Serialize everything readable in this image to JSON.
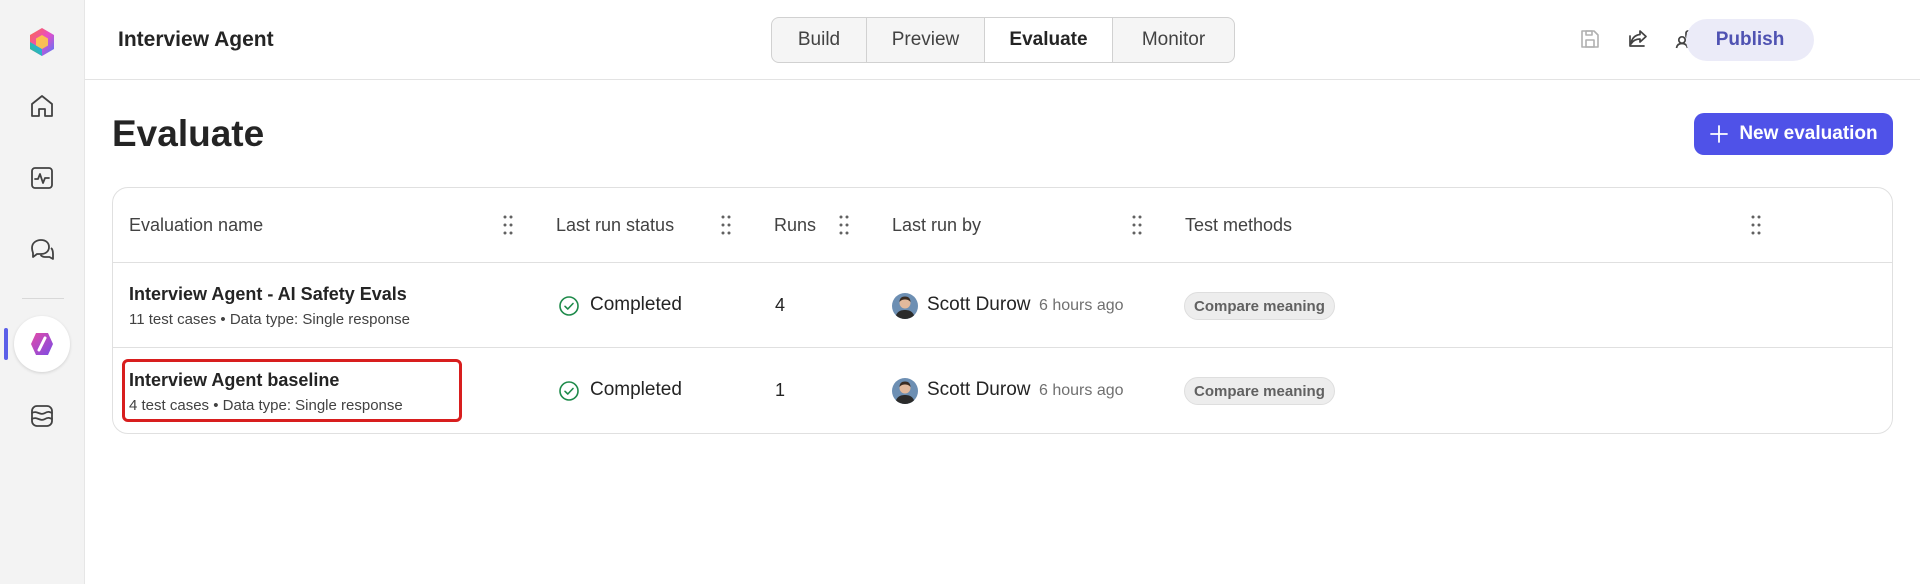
{
  "header": {
    "title": "Interview Agent",
    "tabs": [
      {
        "label": "Build",
        "active": false
      },
      {
        "label": "Preview",
        "active": false
      },
      {
        "label": "Evaluate",
        "active": true
      },
      {
        "label": "Monitor",
        "active": false
      }
    ],
    "icons": [
      "save-icon",
      "share-icon",
      "agent-settings-icon",
      "more-icon"
    ],
    "publish_label": "Publish"
  },
  "rail": {
    "items": [
      "copilot-logo-icon",
      "home-icon",
      "analytics-icon",
      "chat-icon",
      "agents-icon",
      "library-icon"
    ],
    "active_item": "agents-icon"
  },
  "main": {
    "title": "Evaluate",
    "new_button_label": "New evaluation"
  },
  "table": {
    "columns": [
      "Evaluation name",
      "Last run status",
      "Runs",
      "Last run by",
      "Test methods"
    ],
    "rows": [
      {
        "name": "Interview Agent - AI Safety Evals",
        "subtitle": "11 test cases • Data type: Single response",
        "status": "Completed",
        "runs": "4",
        "run_by": "Scott Durow",
        "time": "6 hours ago",
        "method": "Compare meaning"
      },
      {
        "name": "Interview Agent baseline",
        "subtitle": "4 test cases • Data type: Single response",
        "status": "Completed",
        "runs": "1",
        "run_by": "Scott Durow",
        "time": "6 hours ago",
        "method": "Compare meaning"
      }
    ]
  },
  "colors": {
    "accent": "#4f52e8",
    "status_success": "#1e8a4a",
    "highlight": "#d81e1e"
  }
}
